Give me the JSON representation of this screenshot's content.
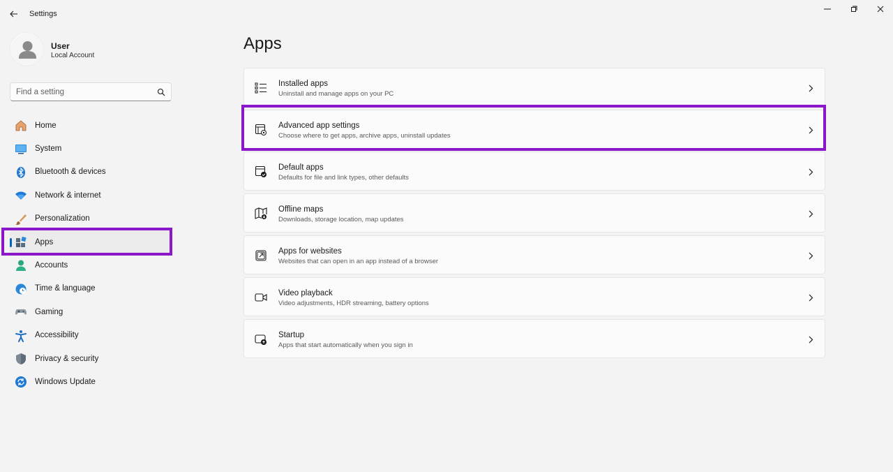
{
  "window": {
    "title": "Settings",
    "controls": [
      "minimize-icon",
      "restore-icon",
      "close-icon"
    ]
  },
  "profile": {
    "name": "User",
    "account_type": "Local Account"
  },
  "search": {
    "placeholder": "Find a setting"
  },
  "sidebar": {
    "items": [
      {
        "label": "Home",
        "icon": "home-icon"
      },
      {
        "label": "System",
        "icon": "system-icon"
      },
      {
        "label": "Bluetooth & devices",
        "icon": "bluetooth-icon"
      },
      {
        "label": "Network & internet",
        "icon": "wifi-icon"
      },
      {
        "label": "Personalization",
        "icon": "brush-icon"
      },
      {
        "label": "Apps",
        "icon": "apps-icon",
        "active": true
      },
      {
        "label": "Accounts",
        "icon": "person-icon"
      },
      {
        "label": "Time & language",
        "icon": "globe-clock-icon"
      },
      {
        "label": "Gaming",
        "icon": "gamepad-icon"
      },
      {
        "label": "Accessibility",
        "icon": "accessibility-icon"
      },
      {
        "label": "Privacy & security",
        "icon": "shield-icon"
      },
      {
        "label": "Windows Update",
        "icon": "update-icon"
      }
    ]
  },
  "main": {
    "title": "Apps",
    "cards": [
      {
        "title": "Installed apps",
        "desc": "Uninstall and manage apps on your PC",
        "icon": "list-icon"
      },
      {
        "title": "Advanced app settings",
        "desc": "Choose where to get apps, archive apps, uninstall updates",
        "icon": "app-settings-icon"
      },
      {
        "title": "Default apps",
        "desc": "Defaults for file and link types, other defaults",
        "icon": "default-apps-icon"
      },
      {
        "title": "Offline maps",
        "desc": "Downloads, storage location, map updates",
        "icon": "map-icon"
      },
      {
        "title": "Apps for websites",
        "desc": "Websites that can open in an app instead of a browser",
        "icon": "open-in-app-icon"
      },
      {
        "title": "Video playback",
        "desc": "Video adjustments, HDR streaming, battery options",
        "icon": "video-icon"
      },
      {
        "title": "Startup",
        "desc": "Apps that start automatically when you sign in",
        "icon": "startup-icon"
      }
    ]
  },
  "colors": {
    "accent": "#0067c0",
    "highlight_box": "#8a17c8",
    "background": "#f3f3f3",
    "card": "#fbfbfb"
  }
}
